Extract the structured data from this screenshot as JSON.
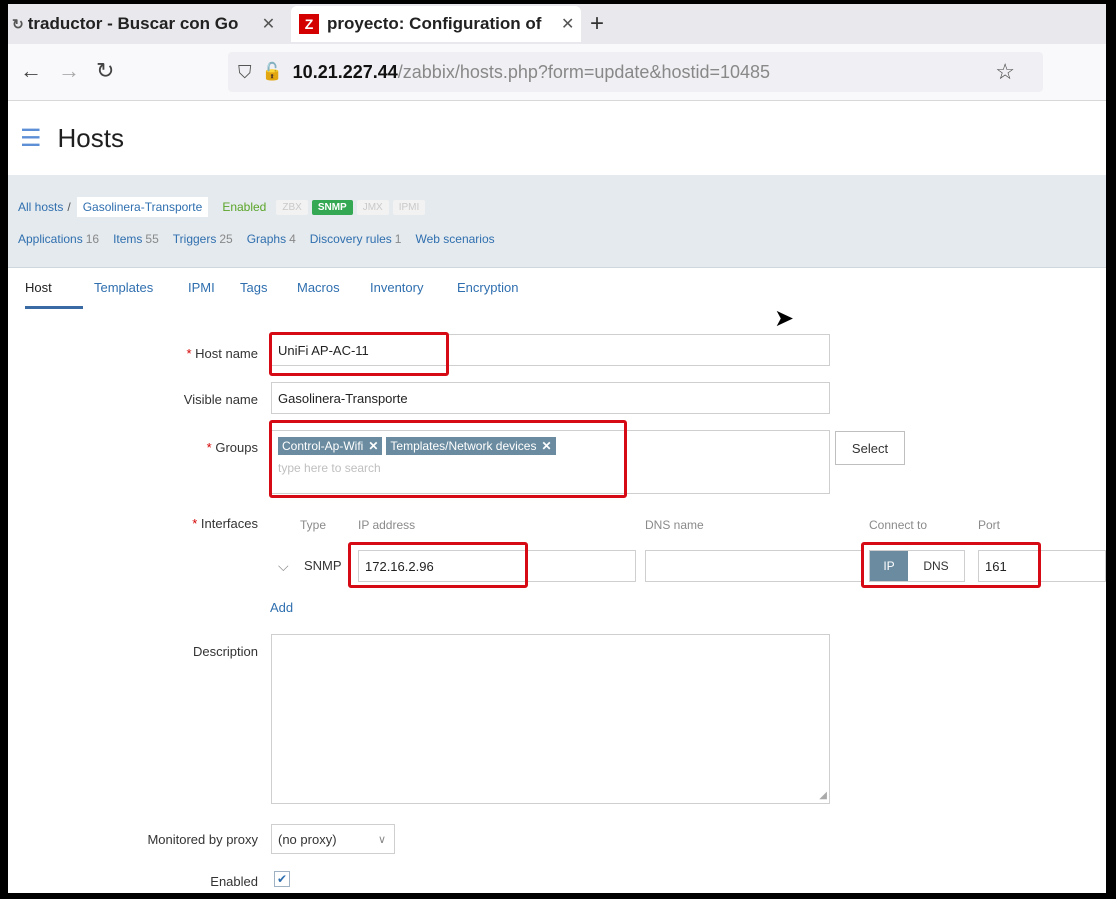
{
  "browser": {
    "tabs": [
      {
        "title": "traductor - Buscar con Go",
        "close": "✕"
      },
      {
        "title": "proyecto: Configuration of",
        "close": "✕",
        "logo": "Z"
      }
    ],
    "new_tab": "+",
    "url_host": "10.21.227.44",
    "url_path": "/zabbix/hosts.php?form=update&hostid=10485"
  },
  "page": {
    "title": "Hosts"
  },
  "host_nav": {
    "all_hosts": "All hosts",
    "separator": "/",
    "host": "Gasolinera-Transporte",
    "status": "Enabled",
    "badges": [
      {
        "label": "ZBX",
        "active": false
      },
      {
        "label": "SNMP",
        "active": true
      },
      {
        "label": "JMX",
        "active": false
      },
      {
        "label": "IPMI",
        "active": false
      }
    ],
    "links": [
      {
        "label": "Applications",
        "count": "16"
      },
      {
        "label": "Items",
        "count": "55"
      },
      {
        "label": "Triggers",
        "count": "25"
      },
      {
        "label": "Graphs",
        "count": "4"
      },
      {
        "label": "Discovery rules",
        "count": "1"
      },
      {
        "label": "Web scenarios",
        "count": ""
      }
    ]
  },
  "form_tabs": [
    "Host",
    "Templates",
    "IPMI",
    "Tags",
    "Macros",
    "Inventory",
    "Encryption"
  ],
  "form": {
    "required_mark": "*",
    "host_name_label": "Host name",
    "host_name": "UniFi AP-AC-11",
    "visible_name_label": "Visible name",
    "visible_name": "Gasolinera-Transporte",
    "groups_label": "Groups",
    "groups": [
      "Control-Ap-Wifi",
      "Templates/Network devices"
    ],
    "groups_placeholder": "type here to search",
    "select_button": "Select",
    "interfaces_label": "Interfaces",
    "columns": {
      "type": "Type",
      "ip": "IP address",
      "dns": "DNS name",
      "connect": "Connect to",
      "port": "Port"
    },
    "interface": {
      "type": "SNMP",
      "ip": "172.16.2.96",
      "dns": "",
      "connect_ip": "IP",
      "connect_dns": "DNS",
      "port": "161"
    },
    "add_link": "Add",
    "description_label": "Description",
    "proxy_label": "Monitored by proxy",
    "proxy_value": "(no proxy)",
    "enabled_label": "Enabled",
    "enabled_checked": true
  },
  "colors": {
    "accent": "#2f6faf",
    "highlight": "#d60a15",
    "enabled": "#5aa52a"
  }
}
